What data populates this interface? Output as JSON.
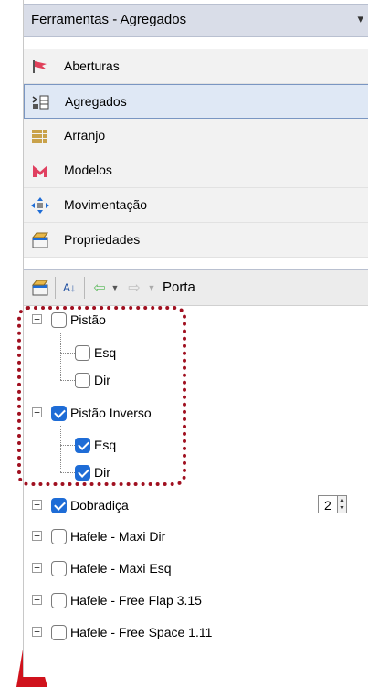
{
  "panel": {
    "title": "Ferramentas - Agregados",
    "pin_icon": "pin-icon"
  },
  "sections": [
    {
      "label": "Aberturas",
      "icon": "aberturas-icon",
      "active": false
    },
    {
      "label": "Agregados",
      "icon": "agregados-icon",
      "active": true
    },
    {
      "label": "Arranjo",
      "icon": "arranjo-icon",
      "active": false
    },
    {
      "label": "Modelos",
      "icon": "modelos-icon",
      "active": false
    },
    {
      "label": "Movimentação",
      "icon": "movimentacao-icon",
      "active": false
    },
    {
      "label": "Propriedades",
      "icon": "propriedades-icon",
      "active": false
    }
  ],
  "toolbar": {
    "label": "Porta"
  },
  "tree": {
    "items": [
      {
        "label": "Pistão",
        "checked": false,
        "expander": "−"
      },
      {
        "label": "Esq",
        "checked": false
      },
      {
        "label": "Dir",
        "checked": false
      },
      {
        "label": "Pistão Inverso",
        "checked": true,
        "expander": "−"
      },
      {
        "label": "Esq",
        "checked": true
      },
      {
        "label": "Dir",
        "checked": true
      },
      {
        "label": "Dobradiça",
        "checked": true,
        "expander": "+",
        "value": "2"
      },
      {
        "label": "Hafele - Maxi Dir",
        "checked": false,
        "expander": "+"
      },
      {
        "label": "Hafele - Maxi Esq",
        "checked": false,
        "expander": "+"
      },
      {
        "label": "Hafele - Free Flap 3.15",
        "checked": false,
        "expander": "+"
      },
      {
        "label": "Hafele - Free Space 1.11",
        "checked": false,
        "expander": "+"
      }
    ]
  },
  "colors": {
    "accent_check": "#1e6cd6",
    "highlight": "#a01020",
    "title_bar": "#d9dde8"
  }
}
